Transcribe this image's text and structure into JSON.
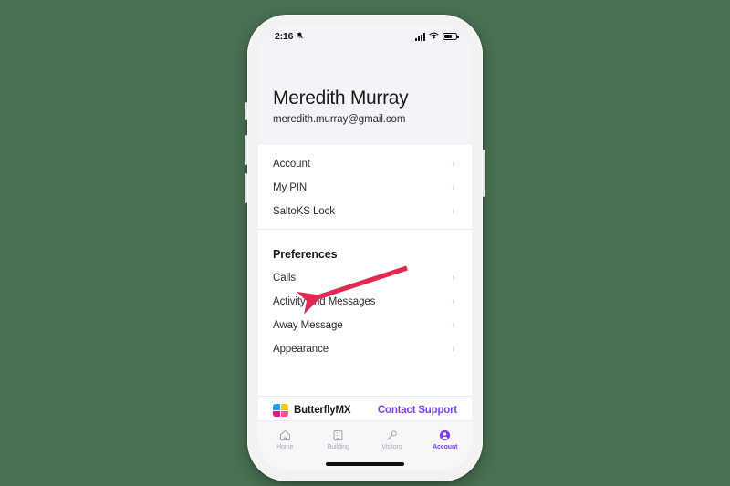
{
  "background_color": "#4b7252",
  "device": {
    "frame_color": "#f2f2f2",
    "screen_background": "#ffffff"
  },
  "status_bar": {
    "time": "2:16",
    "mute_icon": "bell-slash-icon",
    "signal_icon": "cellular-signal-icon",
    "wifi_icon": "wifi-icon",
    "battery_icon": "battery-icon"
  },
  "profile": {
    "name": "Meredith Murray",
    "email": "meredith.murray@gmail.com",
    "header_background": "#f4f4f8"
  },
  "account_group": {
    "items": [
      {
        "label": "Account"
      },
      {
        "label": "My PIN"
      },
      {
        "label": "SaltoKS Lock"
      }
    ]
  },
  "preferences_group": {
    "title": "Preferences",
    "items": [
      {
        "label": "Calls"
      },
      {
        "label": "Activity and Messages"
      },
      {
        "label": "Away Message"
      },
      {
        "label": "Appearance"
      }
    ]
  },
  "footer": {
    "brand_name": "ButterflyMX",
    "brand_logo_icon": "butterfly-logo-icon",
    "contact_support_label": "Contact Support",
    "contact_support_color": "#7b3ff2"
  },
  "tab_bar": {
    "active_color": "#7b3ff2",
    "inactive_color": "#a9a9b2",
    "tabs": [
      {
        "label": "Home",
        "icon": "home-icon",
        "active": false
      },
      {
        "label": "Building",
        "icon": "building-icon",
        "active": false
      },
      {
        "label": "Visitors",
        "icon": "key-icon",
        "active": false
      },
      {
        "label": "Account",
        "icon": "person-circle-icon",
        "active": true
      }
    ]
  },
  "annotation": {
    "type": "arrow",
    "color": "#e22950",
    "points_to": "Calls",
    "direction": "down-left"
  }
}
